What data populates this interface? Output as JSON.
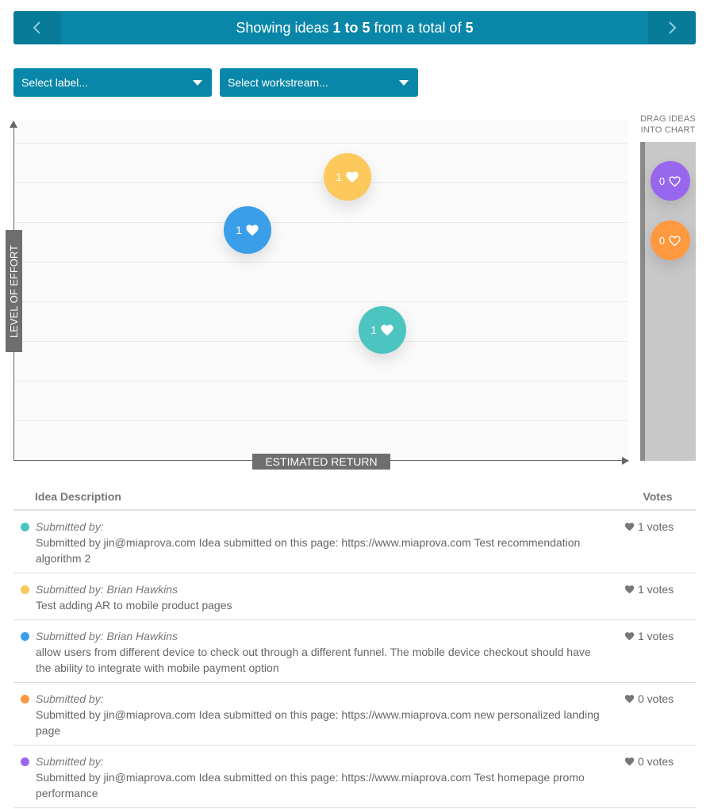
{
  "pager": {
    "prefix": "Showing ideas ",
    "range": "1 to 5",
    "middle": " from a total of ",
    "total": "5"
  },
  "filters": {
    "label_select": "Select label...",
    "workstream_select": "Select workstream..."
  },
  "chart": {
    "y_axis_label": "LEVEL OF EFFORT",
    "x_axis_label": "ESTIMATED RETURN",
    "bubbles": [
      {
        "votes": "1",
        "color": "#fdc95c"
      },
      {
        "votes": "1",
        "color": "#3a9fe8"
      },
      {
        "votes": "1",
        "color": "#4cc4c0"
      }
    ]
  },
  "drag_panel": {
    "title_line1": "DRAG IDEAS",
    "title_line2": "INTO CHART",
    "bubbles": [
      {
        "votes": "0",
        "color": "#9966ee"
      },
      {
        "votes": "0",
        "color": "#ff9940"
      }
    ]
  },
  "table": {
    "header_description": "Idea Description",
    "header_votes": "Votes",
    "rows": [
      {
        "color": "#4cc4c0",
        "submitted_by": "Submitted by:",
        "description": "Submitted by jin@miaprova.com Idea submitted on this page: https://www.miaprova.com Test recommendation algorithm 2",
        "votes": "1 votes"
      },
      {
        "color": "#fdc95c",
        "submitted_by": "Submitted by: Brian Hawkins",
        "description": "Test adding AR to mobile product pages",
        "votes": "1 votes"
      },
      {
        "color": "#3a9fe8",
        "submitted_by": "Submitted by: Brian Hawkins",
        "description": "allow users from different device to check out through a different funnel. The mobile device checkout should have the ability to integrate with mobile payment option",
        "votes": "1 votes"
      },
      {
        "color": "#ff9940",
        "submitted_by": "Submitted by:",
        "description": "Submitted by jin@miaprova.com Idea submitted on this page: https://www.miaprova.com new personalized landing page",
        "votes": "0 votes"
      },
      {
        "color": "#9966ee",
        "submitted_by": "Submitted by:",
        "description": "Submitted by jin@miaprova.com Idea submitted on this page: https://www.miaprova.com Test homepage promo performance",
        "votes": "0 votes"
      }
    ]
  }
}
